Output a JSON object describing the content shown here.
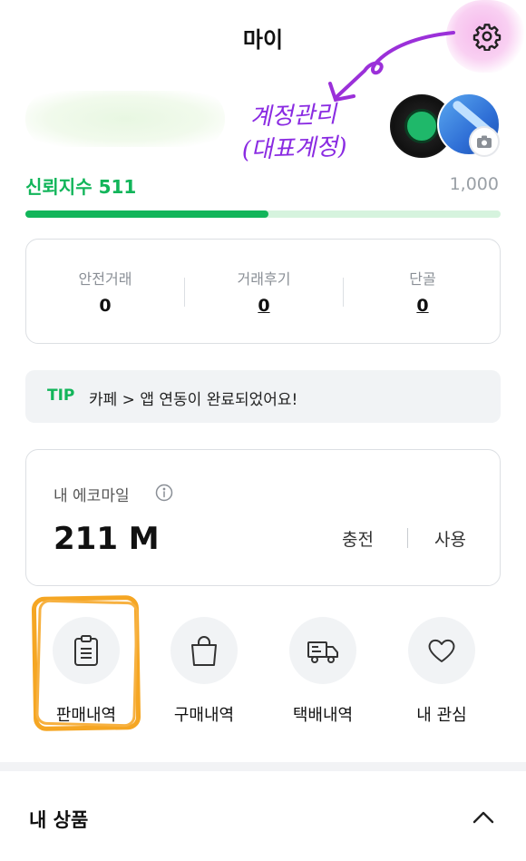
{
  "header": {
    "title": "마이"
  },
  "annotation": {
    "text_line1": "계정관리",
    "text_line2": "(대표계정)",
    "color": "#8a2be2"
  },
  "trust": {
    "label": "신뢰지수 511",
    "max": "1,000",
    "level": 0.511,
    "color": "#12b55a"
  },
  "stats": [
    {
      "label": "안전거래",
      "value": "0"
    },
    {
      "label": "거래후기",
      "value": "0"
    },
    {
      "label": "단골",
      "value": "0"
    }
  ],
  "tip": {
    "tag": "TIP",
    "text": "카페 > 앱 연동이 완료되었어요!"
  },
  "eco": {
    "label": "내 에코마일",
    "amount": "211 M",
    "charge": "충전",
    "use": "사용"
  },
  "menu": [
    {
      "label": "판매내역",
      "icon": "clipboard-icon"
    },
    {
      "label": "구매내역",
      "icon": "shopping-bag-icon"
    },
    {
      "label": "택배내역",
      "icon": "truck-icon"
    },
    {
      "label": "내 관심",
      "icon": "heart-icon"
    }
  ],
  "section": {
    "title": "내 상품"
  }
}
